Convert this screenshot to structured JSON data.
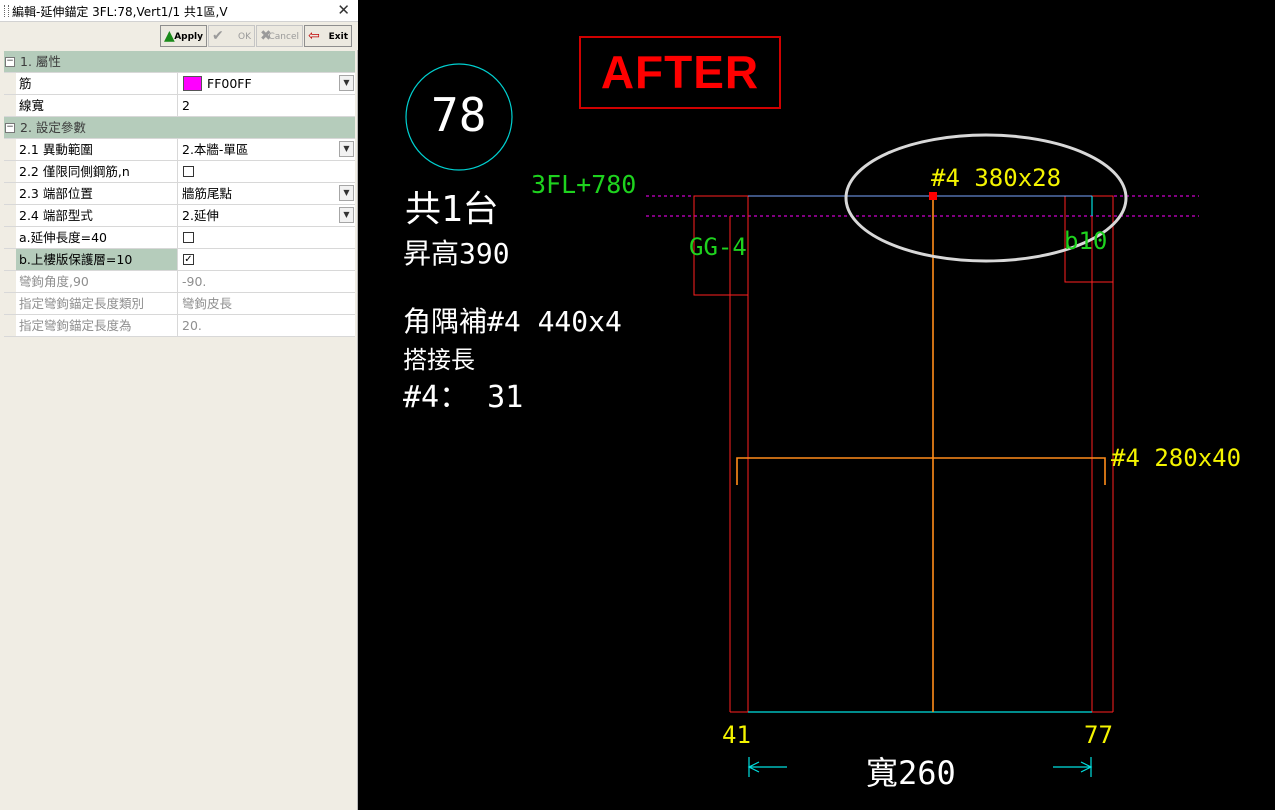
{
  "window": {
    "title": "編輯-延伸錨定 3FL:78,Vert1/1 共1區,V",
    "close_label": "✕"
  },
  "toolbar": {
    "apply_label": "Apply",
    "ok_label": "OK",
    "cancel_label": "Cancel",
    "exit_label": "Exit"
  },
  "properties": {
    "cat1": {
      "label": "1. 屬性",
      "toggle": "−"
    },
    "rebar": {
      "name": "筋",
      "value": "FF00FF",
      "swatch_color": "#ff00ff"
    },
    "linewidth": {
      "name": "線寬",
      "value": "2"
    },
    "cat2": {
      "label": "2. 設定參數",
      "toggle": "−"
    },
    "range": {
      "name": "2.1 異動範圍",
      "value": "2.本牆-單區"
    },
    "sameside": {
      "name": "2.2 僅限同側鋼筋,n",
      "value": ""
    },
    "endpos": {
      "name": "2.3 端部位置",
      "value": "牆筋尾點"
    },
    "endtype": {
      "name": "2.4 端部型式",
      "value": "2.延伸"
    },
    "extlen": {
      "name": "a.延伸長度=40",
      "value": ""
    },
    "cover": {
      "name": "b.上樓版保護層=10",
      "value": "✓"
    },
    "hookangle": {
      "name": "彎鉤角度,90",
      "value": "-90."
    },
    "hooktype": {
      "name": "指定彎鉤錨定長度類別",
      "value": "彎鉤皮長"
    },
    "hooklen": {
      "name": "指定彎鉤錨定長度為",
      "value": "20."
    }
  },
  "cad": {
    "after": "AFTER",
    "circle_number": "78",
    "count": "共1台",
    "rise": "昇高390",
    "corner": "角隅補#4  440x4",
    "lap": "搭接長",
    "lap_value": "#4：  31",
    "level": "3FL+780",
    "top_bar": "#4  380x28",
    "left_beam": "GG-4",
    "right_beam": "b10",
    "mid_bar": "#4  280x40",
    "dim_left": "41",
    "dim_right": "77",
    "width": "寬260"
  }
}
